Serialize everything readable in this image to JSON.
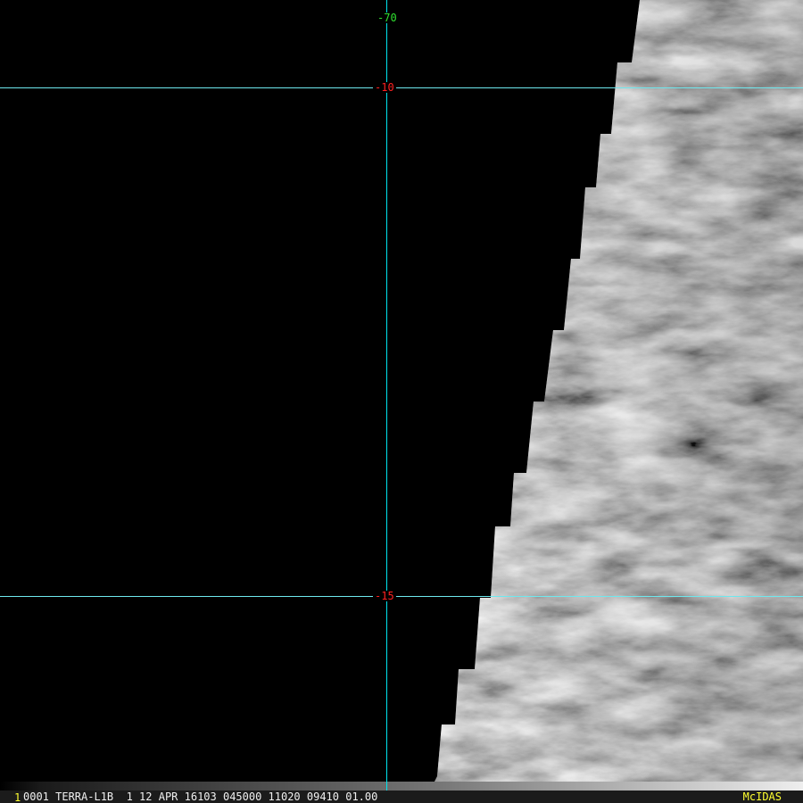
{
  "grid_labels": {
    "longitude": "-70",
    "latitude_top": "-10",
    "latitude_bottom": "-15"
  },
  "status_bar": {
    "frame": "1",
    "text": "0001 TERRA-L1B  1 12 APR 16103 045000 11020 09410 01.00",
    "brand": "McIDAS"
  },
  "colors": {
    "grid": "#00e5ee",
    "latitude_label": "#ff2020",
    "longitude_label": "#30e030",
    "status_highlight": "#ffff30"
  }
}
